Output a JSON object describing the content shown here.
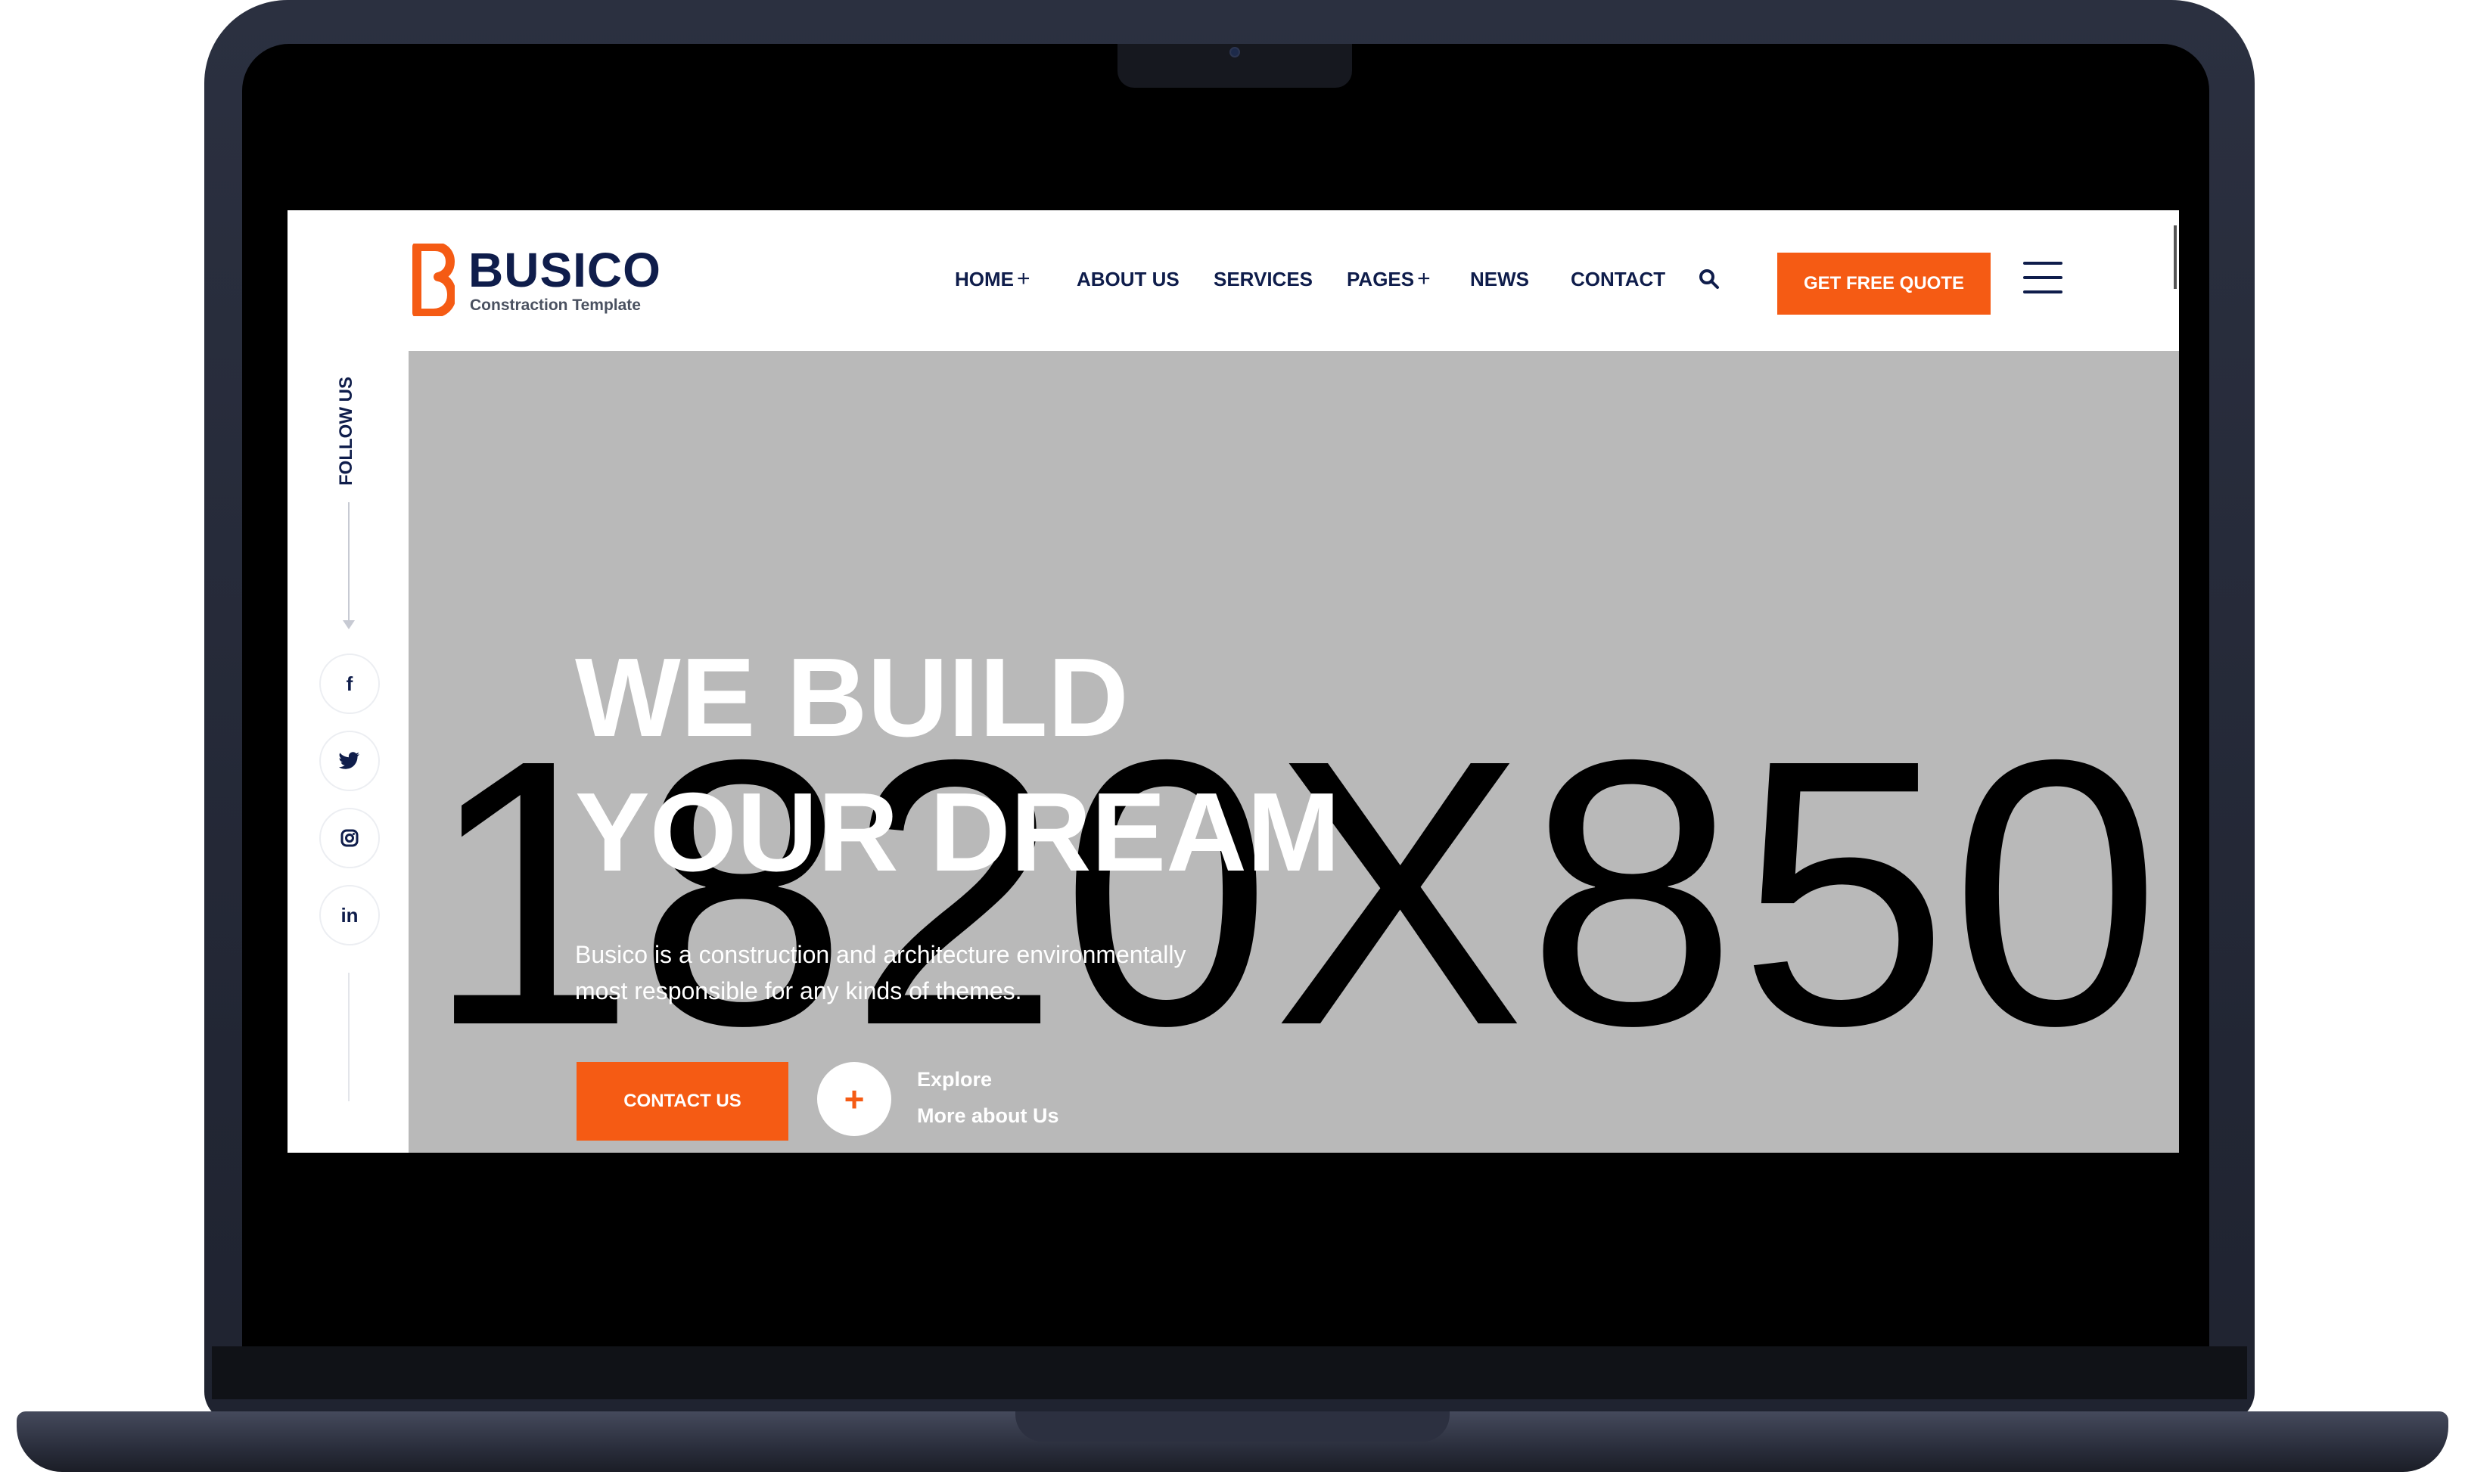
{
  "site": {
    "logo_name": "BUSICO",
    "logo_tagline": "Constraction Template",
    "brand_color": "#f55b14",
    "navy_color": "#0f1d4b"
  },
  "nav": {
    "items": [
      {
        "label": "HOME",
        "has_submenu": true
      },
      {
        "label": "ABOUT US",
        "has_submenu": false
      },
      {
        "label": "SERVICES",
        "has_submenu": false
      },
      {
        "label": "PAGES",
        "has_submenu": true
      },
      {
        "label": "NEWS",
        "has_submenu": false
      },
      {
        "label": "CONTACT",
        "has_submenu": false
      }
    ],
    "submenu_glyph": "+",
    "search_icon": "search-icon",
    "quote_button": "GET FREE QUOTE",
    "menu_icon": "hamburger-menu-icon"
  },
  "sidebar": {
    "follow_label": "FOLLOW US",
    "socials": [
      {
        "name": "facebook",
        "glyph": "f"
      },
      {
        "name": "twitter",
        "glyph": "t"
      },
      {
        "name": "instagram",
        "glyph": "ig"
      },
      {
        "name": "linkedin",
        "glyph": "in"
      }
    ]
  },
  "hero": {
    "placeholder": "1820X850",
    "title_line1": "WE BUILD",
    "title_line2": "YOUR DREAM",
    "text": "Busico is a construction and architecture environmentally most responsible for any kinds of themes.",
    "contact_button": "CONTACT US",
    "explore_plus": "+",
    "explore_line1": "Explore",
    "explore_line2": "More about Us"
  }
}
